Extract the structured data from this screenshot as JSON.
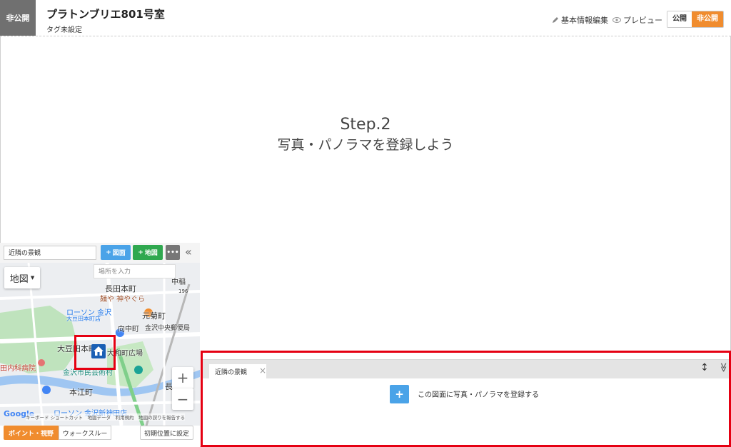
{
  "header": {
    "status_chip": "非公開",
    "title": "プラトンブリエ801号室",
    "tag": "タグ未設定",
    "edit_label": "基本情報編集",
    "preview_label": "プレビュー",
    "public_label": "公開",
    "private_label": "非公開"
  },
  "main": {
    "step_title": "Step.2",
    "step_message": "写真・パノラマを登録しよう"
  },
  "map_panel": {
    "plan_name": "近隣の景観",
    "add_plan_label": "図面",
    "add_map_label": "地図",
    "more_label": "•••",
    "collapse_icon": "«",
    "map_type": "地図",
    "place_placeholder": "場所を入力",
    "zoom_in": "+",
    "zoom_out": "−",
    "labels": {
      "nagata": "長田本町",
      "lawson1": "ローソン 金沢",
      "lawson1b": "大豆田本町店",
      "mugi": "麺や 神やぐら",
      "gankiku": "元菊町",
      "mukai": "向中町",
      "post": "金沢中央郵便局",
      "omame": "大豆田本町",
      "yamato": "大和町広場",
      "mingei": "金沢市民芸術村",
      "clinic": "田内科病院",
      "honE": "本江町",
      "lawson2": "ローソン 金沢新神田店",
      "naga": "長",
      "gun": "中稲",
      "route196": "196"
    },
    "google": "Google",
    "attribution": "キーボード ショートカット　地図データ　利用規約　地図の誤りを報告する",
    "mode_point": "ポイント・視野",
    "mode_walk": "ウォークスルー",
    "reset_label": "初期位置に設定"
  },
  "bottom_panel": {
    "tab_label": "近隣の景観",
    "tab_close": "×",
    "resize_icon": "↕",
    "fold_icon": "≫",
    "add_icon": "+",
    "add_text": "この図面に写真・パノラマを登録する"
  },
  "colors": {
    "accent": "#f08c2e",
    "blue": "#4aa3e8",
    "green": "#2fa84f",
    "highlight": "#e50012"
  }
}
